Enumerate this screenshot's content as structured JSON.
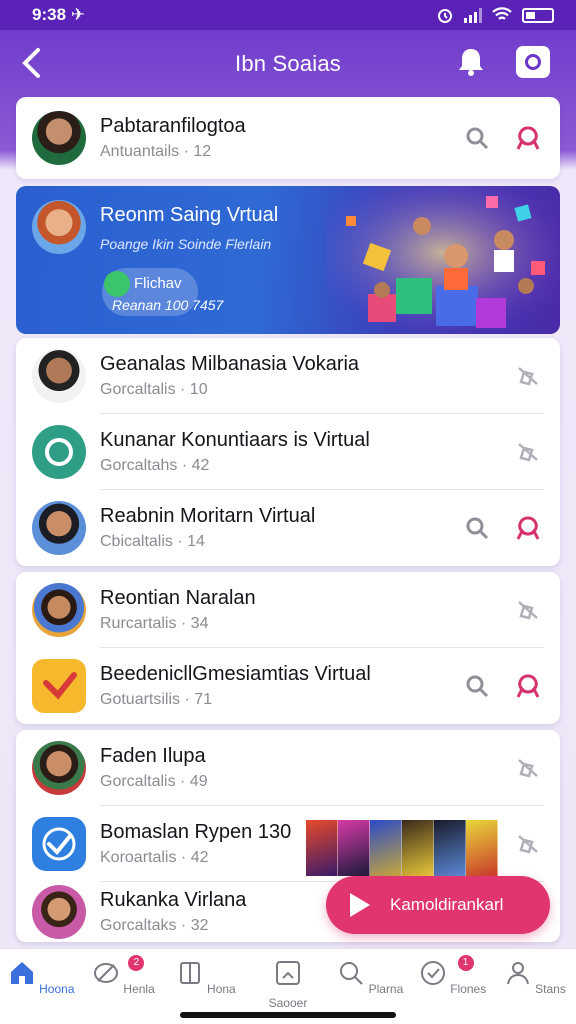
{
  "status": {
    "time": "9:38 ✈"
  },
  "header": {
    "title": "Ibn Soaias"
  },
  "colors": {
    "primary": "#6a35c9",
    "accent": "#e0356f",
    "nav_active": "#3a6fdc"
  },
  "contacts": [
    {
      "name": "Pabtaranfilogtoa",
      "sub": "Antuantails · 12"
    },
    {
      "name": "Geanalas Milbanasia Vokaria",
      "sub": "Gorcaltalis · 10"
    },
    {
      "name": "Kunanar Konuntiaars is Virtual",
      "sub": "Gorcaltahs · 42"
    },
    {
      "name": "Reabnin Moritarn Virtual",
      "sub": "Cbicaltalis · 14"
    },
    {
      "name": "Reontian Naralan",
      "sub": "Rurcartalis · 34"
    },
    {
      "name": "BeedenicllGmesiamtias Virtual",
      "sub": "Gotuartsilis · 71"
    },
    {
      "name": "Faden Ilupa",
      "sub": "Gorcaltalis · 49"
    },
    {
      "name": "Bomaslan Rypen 130",
      "sub": "Koroartalis · 42"
    },
    {
      "name": "Rukanka Virlana",
      "sub": "Gorcaltaks · 32"
    }
  ],
  "banner": {
    "title": "Reonm Saing Vrtual",
    "subtitle": "Poange Ikin Soinde Flerlain",
    "pill_label": "Flichav",
    "pill_sub": "Reanan 100 7457"
  },
  "cta": {
    "label": "Kamoldirankarl"
  },
  "nav": [
    {
      "label": "Hoona",
      "icon": "home-icon",
      "active": true
    },
    {
      "label": "Henla",
      "icon": "leaf-icon",
      "badge": "2"
    },
    {
      "label": "Hona",
      "icon": "book-icon"
    },
    {
      "label": "Saooer",
      "icon": "gallery-icon"
    },
    {
      "label": "Plarna",
      "icon": "search-icon"
    },
    {
      "label": "Flones",
      "icon": "heart-check-icon",
      "badge": "1"
    },
    {
      "label": "Stans",
      "icon": "profile-icon"
    }
  ]
}
